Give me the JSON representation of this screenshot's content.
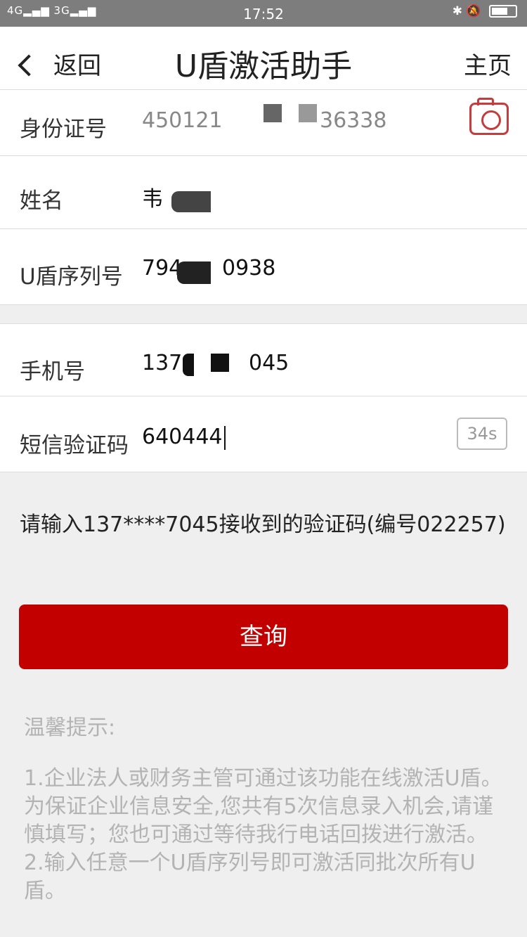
{
  "status_bar": {
    "signal": "4G▂▄▆ 3G▂▄▆",
    "time": "17:52",
    "icons": [
      "bluetooth-icon",
      "alarm-icon",
      "battery-icon"
    ]
  },
  "header": {
    "back_label": "返回",
    "title": "U盾激活助手",
    "home_label": "主页"
  },
  "form": {
    "id_label": "身份证号",
    "id_part1": "450121",
    "id_part2": "36338",
    "name_label": "姓名",
    "name_value": "韦",
    "serial_label": "U盾序列号",
    "serial_part1": "794",
    "serial_part2": "0938",
    "phone_label": "手机号",
    "phone_part1": "137",
    "phone_part2": "045",
    "sms_label": "短信验证码",
    "sms_value": "640444",
    "countdown": "34s"
  },
  "hint": "请输入137****7045接收到的验证码(编号022257)",
  "query_button": "查询",
  "tips": {
    "title": "温馨提示:",
    "body": "1.企业法人或财务主管可通过该功能在线激活U盾。为保证企业信息安全,您共有5次信息录入机会,请谨慎填写；您也可通过等待我行电话回拨进行激活。\n2.输入任意一个U盾序列号即可激活同批次所有U盾。"
  },
  "colors": {
    "accent": "#c20000",
    "camera": "#c43c3c"
  }
}
